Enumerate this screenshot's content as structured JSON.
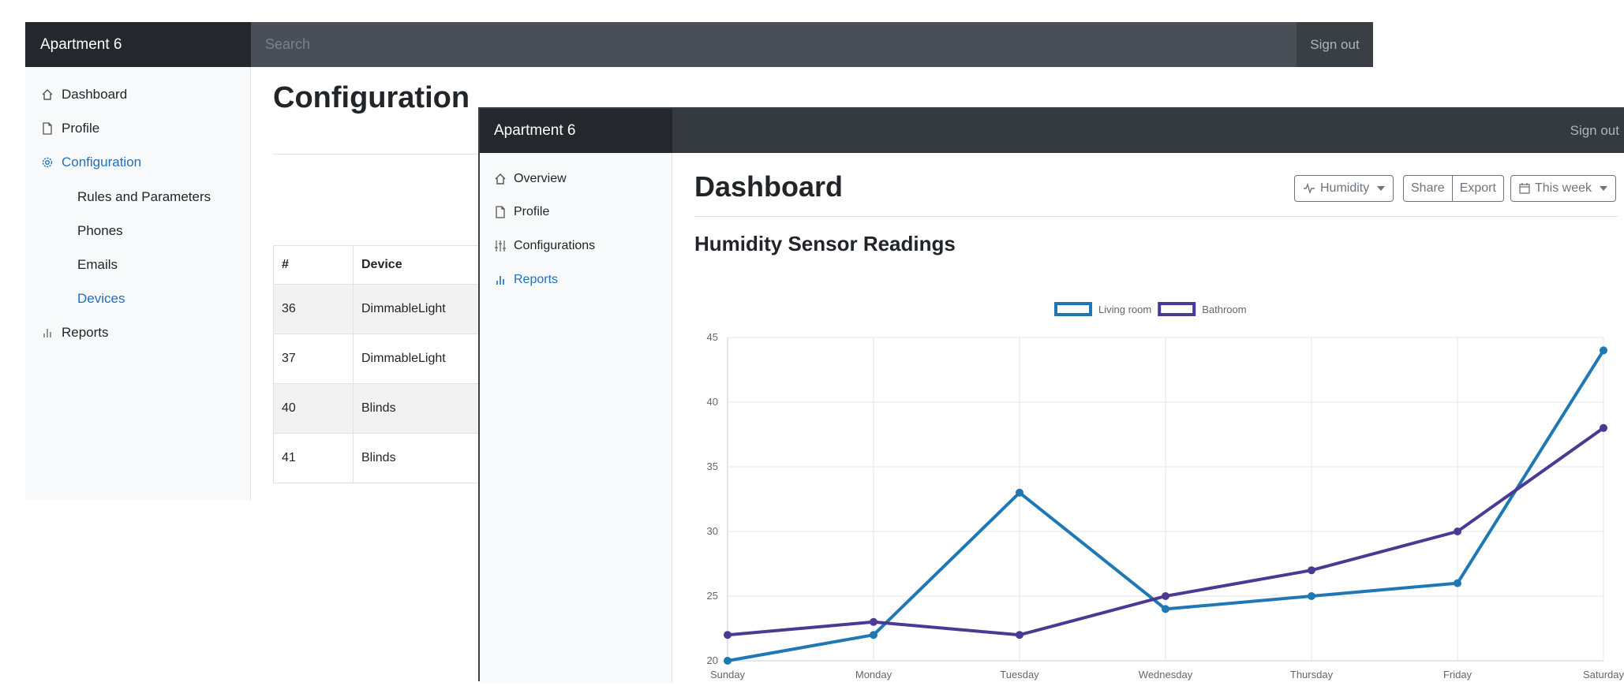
{
  "back_window": {
    "brand": "Apartment 6",
    "search_placeholder": "Search",
    "sign_out": "Sign out",
    "sidebar": {
      "items": [
        {
          "label": "Dashboard",
          "icon": "home-icon"
        },
        {
          "label": "Profile",
          "icon": "file-icon"
        },
        {
          "label": "Configuration",
          "icon": "gear-icon",
          "active": true
        },
        {
          "label": "Reports",
          "icon": "bar-chart-icon"
        }
      ],
      "sub_items": [
        {
          "label": "Rules and Parameters"
        },
        {
          "label": "Phones"
        },
        {
          "label": "Emails"
        },
        {
          "label": "Devices",
          "active": true
        }
      ]
    },
    "page_title": "Configuration",
    "table": {
      "headers": [
        "#",
        "Device"
      ],
      "rows": [
        [
          "36",
          "DimmableLight"
        ],
        [
          "37",
          "DimmableLight"
        ],
        [
          "40",
          "Blinds"
        ],
        [
          "41",
          "Blinds"
        ]
      ]
    }
  },
  "front_window": {
    "brand": "Apartment 6",
    "sign_out": "Sign out",
    "sidebar": {
      "items": [
        {
          "label": "Overview",
          "icon": "home-icon"
        },
        {
          "label": "Profile",
          "icon": "file-icon"
        },
        {
          "label": "Configurations",
          "icon": "sliders-icon"
        },
        {
          "label": "Reports",
          "icon": "bar-chart-icon",
          "active": true
        }
      ]
    },
    "page_title": "Dashboard",
    "toolbar": {
      "sensor_dropdown": "Humidity",
      "share": "Share",
      "export": "Export",
      "range_dropdown": "This week"
    },
    "section_title": "Humidity Sensor Readings"
  },
  "colors": {
    "accent": "#1f6fbf",
    "living_room": "#1f77b4",
    "bathroom": "#4b3a93"
  },
  "chart_data": {
    "type": "line",
    "title": "",
    "x": [
      "Sunday",
      "Monday",
      "Tuesday",
      "Wednesday",
      "Thursday",
      "Friday",
      "Saturday"
    ],
    "ylim": [
      20,
      45
    ],
    "yticks": [
      20,
      25,
      30,
      35,
      40,
      45
    ],
    "grid": true,
    "legend": "top-center",
    "series": [
      {
        "name": "Living room",
        "values": [
          20,
          22,
          33,
          24,
          25,
          26,
          44
        ]
      },
      {
        "name": "Bathroom",
        "values": [
          22,
          23,
          22,
          25,
          27,
          30,
          38
        ]
      }
    ]
  }
}
